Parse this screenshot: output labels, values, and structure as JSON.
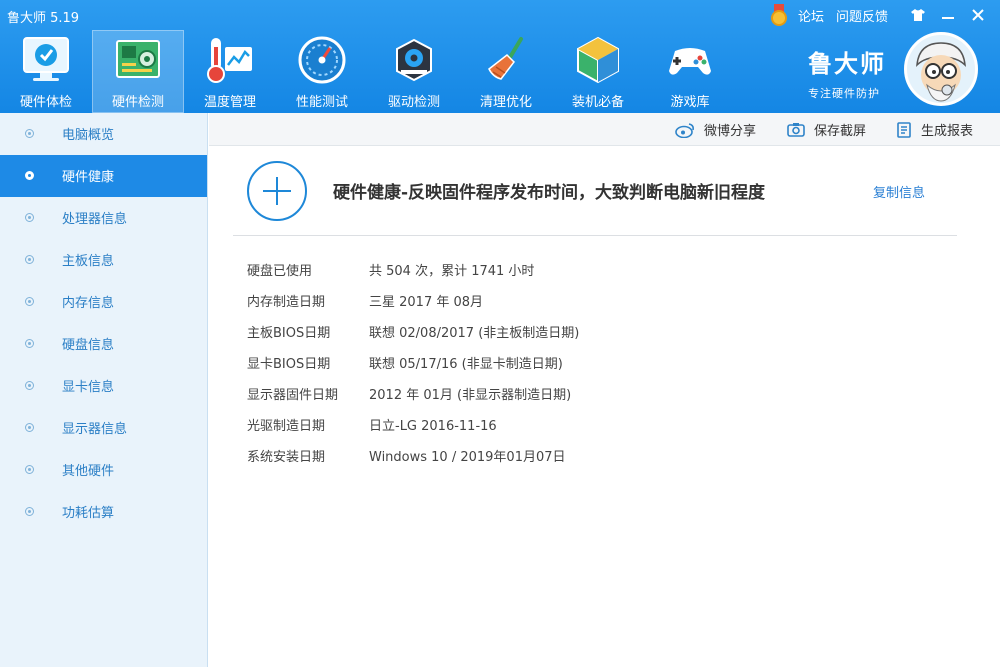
{
  "app": {
    "title": "鲁大师 5.19"
  },
  "top_links": {
    "forum": "论坛",
    "feedback": "问题反馈"
  },
  "window_controls": {
    "skin_icon": "shirt-icon",
    "minimize_icon": "minimize-icon",
    "close_icon": "close-icon"
  },
  "tabs": [
    {
      "label": "硬件体检",
      "icon": "monitor-check-icon"
    },
    {
      "label": "硬件检测",
      "icon": "circuit-board-icon",
      "active": true
    },
    {
      "label": "温度管理",
      "icon": "thermometer-icon"
    },
    {
      "label": "性能测试",
      "icon": "speedometer-icon"
    },
    {
      "label": "驱动检测",
      "icon": "driver-gear-icon"
    },
    {
      "label": "清理优化",
      "icon": "broom-icon"
    },
    {
      "label": "装机必备",
      "icon": "package-box-icon"
    },
    {
      "label": "游戏库",
      "icon": "gamepad-icon"
    }
  ],
  "brand": {
    "name": "鲁大师",
    "slogan": "专注硬件防护"
  },
  "sidebar": {
    "items": [
      {
        "label": "电脑概览"
      },
      {
        "label": "硬件健康",
        "active": true
      },
      {
        "label": "处理器信息"
      },
      {
        "label": "主板信息"
      },
      {
        "label": "内存信息"
      },
      {
        "label": "硬盘信息"
      },
      {
        "label": "显卡信息"
      },
      {
        "label": "显示器信息"
      },
      {
        "label": "其他硬件"
      },
      {
        "label": "功耗估算"
      }
    ]
  },
  "toolbar": {
    "weibo_share": "微博分享",
    "save_screenshot": "保存截屏",
    "generate_report": "生成报表"
  },
  "main": {
    "headline": "硬件健康-反映固件程序发布时间，大致判断电脑新旧程度",
    "copy_label": "复制信息",
    "rows": [
      {
        "key": "硬盘已使用",
        "value": "共 504 次，累计 1741 小时"
      },
      {
        "key": "内存制造日期",
        "value": "三星 2017 年 08月"
      },
      {
        "key": "主板BIOS日期",
        "value": "联想 02/08/2017 (非主板制造日期)"
      },
      {
        "key": "显卡BIOS日期",
        "value": "联想 05/17/16 (非显卡制造日期)"
      },
      {
        "key": "显示器固件日期",
        "value": "2012 年 01月 (非显示器制造日期)"
      },
      {
        "key": "光驱制造日期",
        "value": "日立-LG 2016-11-16"
      },
      {
        "key": "系统安装日期",
        "value": "Windows 10 / 2019年01月07日"
      }
    ]
  },
  "colors": {
    "header": "#1a8ce8",
    "sidebar_bg": "#e9f3fb",
    "active": "#1e8ae6",
    "link": "#2a7fd4"
  }
}
